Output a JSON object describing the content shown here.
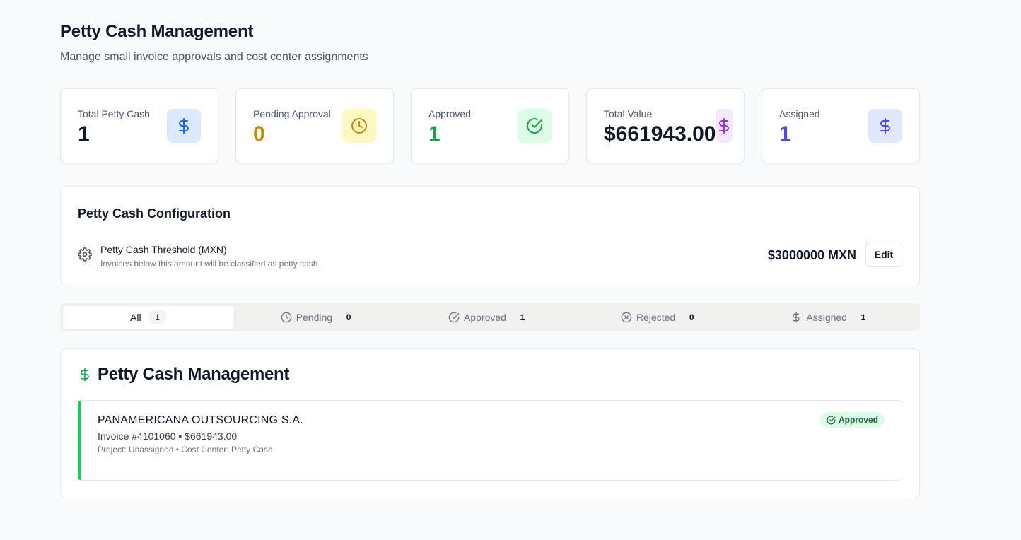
{
  "header": {
    "title": "Petty Cash Management",
    "subtitle": "Manage small invoice approvals and cost center assignments"
  },
  "stats": [
    {
      "label": "Total Petty Cash",
      "value": "1",
      "icon": "dollar-icon",
      "value_color": "#111827",
      "icon_bg": "#dbeafe",
      "icon_color": "#2563eb"
    },
    {
      "label": "Pending Approval",
      "value": "0",
      "icon": "clock-icon",
      "value_color": "#ca8a04",
      "icon_bg": "#fef9c3",
      "icon_color": "#ca8a04"
    },
    {
      "label": "Approved",
      "value": "1",
      "icon": "check-circle-icon",
      "value_color": "#16a34a",
      "icon_bg": "#dcfce7",
      "icon_color": "#16a34a"
    },
    {
      "label": "Total Value",
      "value": "$661943.00",
      "icon": "dollar-icon",
      "value_color": "#111827",
      "icon_bg": "#f3e8ff",
      "icon_color": "#9333ea"
    },
    {
      "label": "Assigned",
      "value": "1",
      "icon": "dollar-icon",
      "value_color": "#4f46e5",
      "icon_bg": "#e0e7ff",
      "icon_color": "#4f46e5"
    }
  ],
  "config": {
    "title": "Petty Cash Configuration",
    "threshold_label": "Petty Cash Threshold (MXN)",
    "threshold_desc": "Invoices below this amount will be classified as petty cash",
    "threshold_value": "$3000000 MXN",
    "edit_label": "Edit"
  },
  "tabs": [
    {
      "label": "All",
      "count": "1",
      "icon": ""
    },
    {
      "label": "Pending",
      "count": "0",
      "icon": "clock-icon"
    },
    {
      "label": "Approved",
      "count": "1",
      "icon": "check-circle-icon"
    },
    {
      "label": "Rejected",
      "count": "0",
      "icon": "x-circle-icon"
    },
    {
      "label": "Assigned",
      "count": "1",
      "icon": "dollar-icon"
    }
  ],
  "list": {
    "title": "Petty Cash Management",
    "entries": [
      {
        "vendor": "PANAMERICANA OUTSOURCING S.A.",
        "invoice": "Invoice #4101060 • $661943.00",
        "meta": "Project: Unassigned • Cost Center: Petty Cash",
        "status": "Approved",
        "accent": "#22c55e"
      }
    ]
  }
}
